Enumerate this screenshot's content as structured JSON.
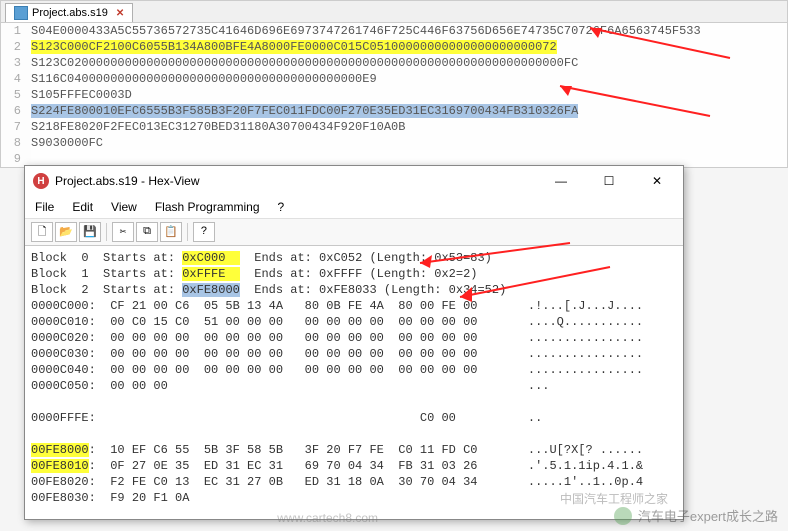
{
  "editor": {
    "tab": {
      "filename": "Project.abs.s19"
    },
    "lines": [
      {
        "n": 1,
        "pre": "",
        "mid": "",
        "post": "S04E0000433A5C55736572735C41646D696E6973747261746F725C446F63756D656E74735C70726F6A6563745F533"
      },
      {
        "n": 2,
        "pre": "",
        "mid": "S123C000CF2100C6055B134A800BFE4A8000FE0000C015C05100000000000000000000072",
        "post": "",
        "hl": "y"
      },
      {
        "n": 3,
        "pre": "",
        "mid": "",
        "post": "S123C020000000000000000000000000000000000000000000000000000000000000000000FC"
      },
      {
        "n": 4,
        "pre": "",
        "mid": "",
        "post": "S116C04000000000000000000000000000000000000000E9"
      },
      {
        "n": 5,
        "pre": "",
        "mid": "",
        "post": "S105FFFEC0003D"
      },
      {
        "n": 6,
        "pre": "",
        "mid": "S224FE800010EFC6555B3F585B3F20F7FEC011FDC00F270E35ED31EC3169700434FB310326FA",
        "post": "",
        "hl": "b"
      },
      {
        "n": 7,
        "pre": "",
        "mid": "",
        "post": "S218FE8020F2FEC013EC31270BED31180A30700434F920F10A0B"
      },
      {
        "n": 8,
        "pre": "",
        "mid": "",
        "post": "S9030000FC"
      },
      {
        "n": 9,
        "pre": "",
        "mid": "",
        "post": ""
      }
    ]
  },
  "hexwin": {
    "title": "Project.abs.s19 - Hex-View",
    "menus": [
      "File",
      "Edit",
      "View",
      "Flash Programming",
      "?"
    ],
    "blocks": [
      {
        "idx": "0",
        "start": "0xC000",
        "end": "0xC052",
        "lenhex": "0x53",
        "lendec": "83",
        "hl": "y"
      },
      {
        "idx": "1",
        "start": "0xFFFE",
        "end": "0xFFFF",
        "lenhex": "0x2",
        "lendec": "2",
        "hl": "y"
      },
      {
        "idx": "2",
        "start": "0xFE8000",
        "end": "0xFE8033",
        "lenhex": "0x34",
        "lendec": "52",
        "hl": "b"
      }
    ],
    "rows": [
      {
        "addr": "0000C000",
        "hex": " CF 21 00 C6  05 5B 13 4A   80 0B FE 4A  80 00 FE 00",
        "asc": ".!...[.J...J...."
      },
      {
        "addr": "0000C010",
        "hex": " 00 C0 15 C0  51 00 00 00   00 00 00 00  00 00 00 00",
        "asc": "....Q..........."
      },
      {
        "addr": "0000C020",
        "hex": " 00 00 00 00  00 00 00 00   00 00 00 00  00 00 00 00",
        "asc": "................"
      },
      {
        "addr": "0000C030",
        "hex": " 00 00 00 00  00 00 00 00   00 00 00 00  00 00 00 00",
        "asc": "................"
      },
      {
        "addr": "0000C040",
        "hex": " 00 00 00 00  00 00 00 00   00 00 00 00  00 00 00 00",
        "asc": "................"
      },
      {
        "addr": "0000C050",
        "hex": " 00 00 00",
        "asc": "..."
      },
      {
        "addr": "",
        "hex": "",
        "asc": ""
      },
      {
        "addr": "0000FFFE",
        "hex": "                                            C0 00",
        "asc": ".."
      },
      {
        "addr": "",
        "hex": "",
        "asc": ""
      },
      {
        "addr": "00FE8000",
        "hex": " 10 EF C6 55  5B 3F 58 5B   3F 20 F7 FE  C0 11 FD C0",
        "asc": "...U[?X[? ......",
        "hl": "y"
      },
      {
        "addr": "00FE8010",
        "hex": " 0F 27 0E 35  ED 31 EC 31   69 70 04 34  FB 31 03 26",
        "asc": ".'.5.1.1ip.4.1.&",
        "hl": "y"
      },
      {
        "addr": "00FE8020",
        "hex": " F2 FE C0 13  EC 31 27 0B   ED 31 18 0A  30 70 04 34",
        "asc": ".....1'..1..0p.4"
      },
      {
        "addr": "00FE8030",
        "hex": " F9 20 F1 0A",
        "asc": ""
      }
    ]
  },
  "watermark": {
    "text1": "汽车电子expert成长之路",
    "text2": "中国汽车工程师之家",
    "url": "www.cartech8.com"
  }
}
